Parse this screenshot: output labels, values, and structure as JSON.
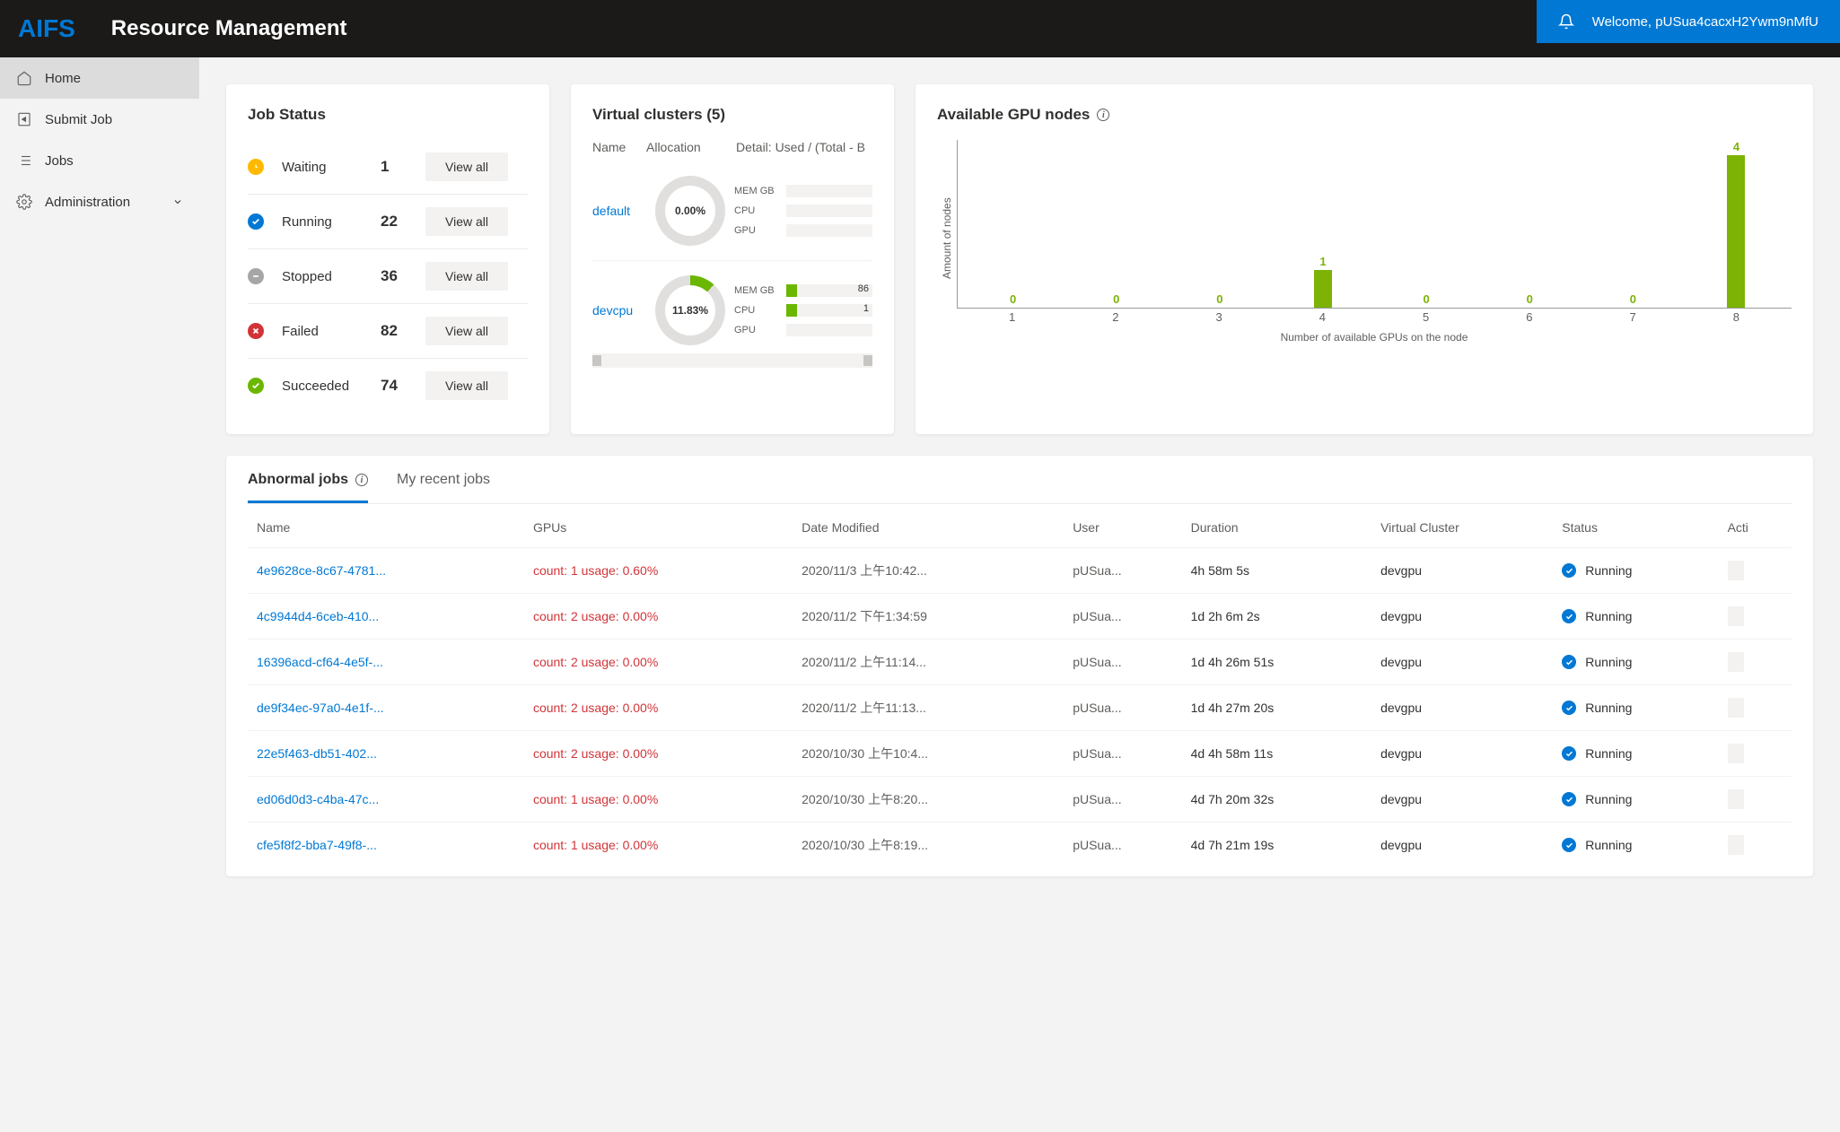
{
  "header": {
    "logo": "AIFS",
    "title": "Resource Management",
    "welcome": "Welcome, pUSua4cacxH2Ywm9nMfU"
  },
  "sidebar": {
    "items": [
      {
        "label": "Home",
        "icon": "home"
      },
      {
        "label": "Submit Job",
        "icon": "submit"
      },
      {
        "label": "Jobs",
        "icon": "list"
      },
      {
        "label": "Administration",
        "icon": "gear",
        "chevron": true
      }
    ]
  },
  "jobStatus": {
    "title": "Job Status",
    "viewAll": "View all",
    "items": [
      {
        "label": "Waiting",
        "count": "1",
        "style": "waiting"
      },
      {
        "label": "Running",
        "count": "22",
        "style": "running"
      },
      {
        "label": "Stopped",
        "count": "36",
        "style": "stopped"
      },
      {
        "label": "Failed",
        "count": "82",
        "style": "failed"
      },
      {
        "label": "Succeeded",
        "count": "74",
        "style": "succeeded"
      }
    ]
  },
  "virtualClusters": {
    "title": "Virtual clusters (5)",
    "headers": {
      "name": "Name",
      "alloc": "Allocation",
      "detail": "Detail: Used / (Total - B"
    },
    "rows": [
      {
        "name": "default",
        "pct": "0.00%",
        "donutPercent": 0,
        "details": [
          {
            "label": "MEM GB",
            "fill": 0,
            "val": ""
          },
          {
            "label": "CPU",
            "fill": 0,
            "val": ""
          },
          {
            "label": "GPU",
            "fill": 0,
            "val": ""
          }
        ]
      },
      {
        "name": "devcpu",
        "pct": "11.83%",
        "donutPercent": 11.83,
        "details": [
          {
            "label": "MEM GB",
            "fill": 12,
            "val": "86"
          },
          {
            "label": "CPU",
            "fill": 12,
            "val": "1"
          },
          {
            "label": "GPU",
            "fill": 0,
            "val": ""
          }
        ]
      }
    ]
  },
  "gpu": {
    "title": "Available GPU nodes",
    "ylabel": "Amount of nodes",
    "xlabel": "Number of available GPUs on the node"
  },
  "chart_data": {
    "type": "bar",
    "categories": [
      "1",
      "2",
      "3",
      "4",
      "5",
      "6",
      "7",
      "8"
    ],
    "values": [
      0,
      0,
      0,
      1,
      0,
      0,
      0,
      4
    ],
    "title": "Available GPU nodes",
    "xlabel": "Number of available GPUs on the node",
    "ylabel": "Amount of nodes",
    "ylim": [
      0,
      4
    ]
  },
  "jobsPanel": {
    "tabs": [
      "Abnormal jobs",
      "My recent jobs"
    ],
    "columns": [
      "Name",
      "GPUs",
      "Date Modified",
      "User",
      "Duration",
      "Virtual Cluster",
      "Status",
      "Acti"
    ],
    "rows": [
      {
        "name": "4e9628ce-8c67-4781...",
        "gpus": "count: 1 usage: 0.60%",
        "date": "2020/11/3 上午10:42...",
        "user": "pUSua...",
        "duration": "4h 58m 5s",
        "vc": "devgpu",
        "status": "Running"
      },
      {
        "name": "4c9944d4-6ceb-410...",
        "gpus": "count: 2 usage: 0.00%",
        "date": "2020/11/2 下午1:34:59",
        "user": "pUSua...",
        "duration": "1d 2h 6m 2s",
        "vc": "devgpu",
        "status": "Running"
      },
      {
        "name": "16396acd-cf64-4e5f-...",
        "gpus": "count: 2 usage: 0.00%",
        "date": "2020/11/2 上午11:14...",
        "user": "pUSua...",
        "duration": "1d 4h 26m 51s",
        "vc": "devgpu",
        "status": "Running"
      },
      {
        "name": "de9f34ec-97a0-4e1f-...",
        "gpus": "count: 2 usage: 0.00%",
        "date": "2020/11/2 上午11:13...",
        "user": "pUSua...",
        "duration": "1d 4h 27m 20s",
        "vc": "devgpu",
        "status": "Running"
      },
      {
        "name": "22e5f463-db51-402...",
        "gpus": "count: 2 usage: 0.00%",
        "date": "2020/10/30 上午10:4...",
        "user": "pUSua...",
        "duration": "4d 4h 58m 11s",
        "vc": "devgpu",
        "status": "Running"
      },
      {
        "name": "ed06d0d3-c4ba-47c...",
        "gpus": "count: 1 usage: 0.00%",
        "date": "2020/10/30 上午8:20...",
        "user": "pUSua...",
        "duration": "4d 7h 20m 32s",
        "vc": "devgpu",
        "status": "Running"
      },
      {
        "name": "cfe5f8f2-bba7-49f8-...",
        "gpus": "count: 1 usage: 0.00%",
        "date": "2020/10/30 上午8:19...",
        "user": "pUSua...",
        "duration": "4d 7h 21m 19s",
        "vc": "devgpu",
        "status": "Running"
      }
    ]
  }
}
